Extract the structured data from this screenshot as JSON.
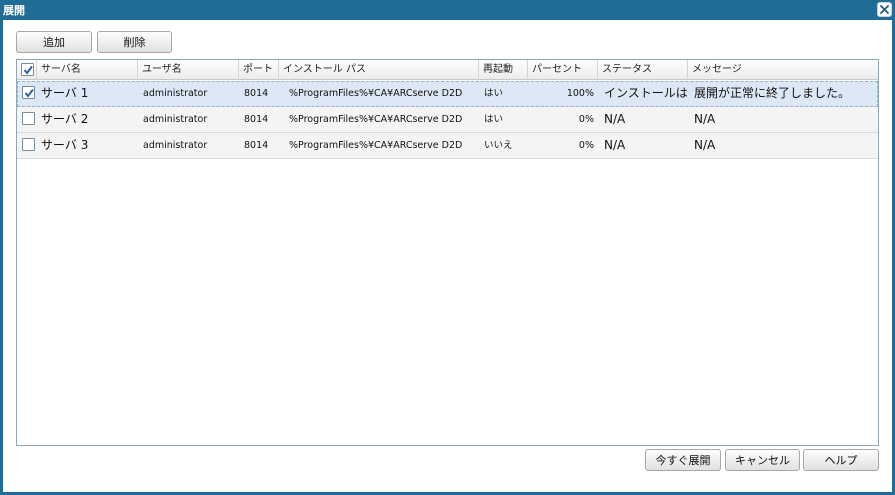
{
  "window": {
    "title": "展開"
  },
  "toolbar": {
    "add_label": "追加",
    "delete_label": "削除"
  },
  "grid": {
    "columns": [
      "サーバ名",
      "ユーザ名",
      "ポート",
      "インストール パス",
      "再起動",
      "パーセント",
      "ステータス",
      "メッセージ"
    ],
    "header_checkbox_checked": true,
    "rows": [
      {
        "checked": true,
        "server": "サーバ 1",
        "user": "administrator",
        "port": "8014",
        "path": "%ProgramFiles%¥CA¥ARCserve D2D",
        "reboot": "はい",
        "percent": "100%",
        "status": "インストールは正…",
        "message": "展開が正常に終了しました。"
      },
      {
        "checked": false,
        "server": "サーバ 2",
        "user": "administrator",
        "port": "8014",
        "path": "%ProgramFiles%¥CA¥ARCserve D2D",
        "reboot": "はい",
        "percent": "0%",
        "status": "N/A",
        "message": "N/A"
      },
      {
        "checked": false,
        "server": "サーバ 3",
        "user": "administrator",
        "port": "8014",
        "path": "%ProgramFiles%¥CA¥ARCserve D2D",
        "reboot": "いいえ",
        "percent": "0%",
        "status": "N/A",
        "message": "N/A"
      }
    ]
  },
  "footer": {
    "deploy_now_label": "今すぐ展開",
    "cancel_label": "キャンセル",
    "help_label": "ヘルプ"
  },
  "colors": {
    "titlebar": "#1f6c94",
    "selected_row": "#dde8f6",
    "checkmark": "#2b5fa8"
  },
  "icons": {
    "close": "close-icon",
    "check": "checkmark-icon"
  }
}
